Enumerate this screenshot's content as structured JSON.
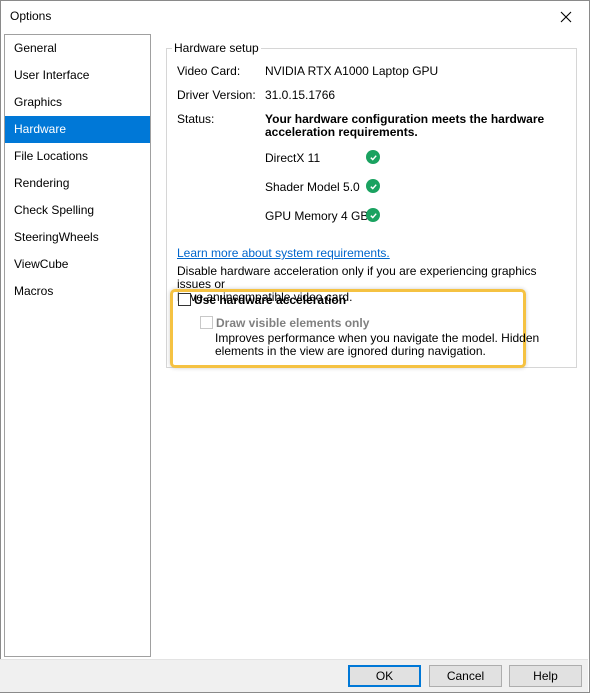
{
  "window": {
    "title": "Options"
  },
  "nav": {
    "items": [
      {
        "label": "General"
      },
      {
        "label": "User Interface"
      },
      {
        "label": "Graphics"
      },
      {
        "label": "Hardware",
        "selected": true
      },
      {
        "label": "File Locations"
      },
      {
        "label": "Rendering"
      },
      {
        "label": "Check Spelling"
      },
      {
        "label": "SteeringWheels"
      },
      {
        "label": "ViewCube"
      },
      {
        "label": "Macros"
      }
    ]
  },
  "hardware": {
    "group_title": "Hardware setup",
    "video_card_label": "Video Card:",
    "video_card_value": "NVIDIA RTX A1000 Laptop GPU",
    "driver_label": "Driver Version:",
    "driver_value": "31.0.15.1766",
    "status_label": "Status:",
    "status_line1": "Your hardware configuration meets the hardware",
    "status_line2": "acceleration requirements.",
    "requirements": [
      {
        "label": "DirectX 11",
        "icon": "check-circle-icon"
      },
      {
        "label": "Shader Model 5.0",
        "icon": "check-circle-icon"
      },
      {
        "label": "GPU Memory 4 GB",
        "icon": "check-circle-icon"
      }
    ],
    "learn_more_link": "Learn more about system requirements.",
    "disable_note_line1": "Disable hardware acceleration only if you are experiencing graphics issues or",
    "disable_note_line2": "have an incompatible video card.",
    "use_hw_accel_label": "Use hardware acceleration",
    "use_hw_accel_checked": false,
    "draw_visible_label": "Draw visible elements only",
    "draw_visible_checked": false,
    "draw_visible_enabled": false,
    "draw_visible_desc_line1": "Improves performance when you navigate the model. Hidden",
    "draw_visible_desc_line2": "elements in the view are ignored during navigation."
  },
  "footer": {
    "ok_label": "OK",
    "cancel_label": "Cancel",
    "help_label": "Help"
  },
  "colors": {
    "selection": "#0078d7",
    "check_green": "#1aa260",
    "highlight": "#f5c242",
    "link": "#0066cc"
  }
}
